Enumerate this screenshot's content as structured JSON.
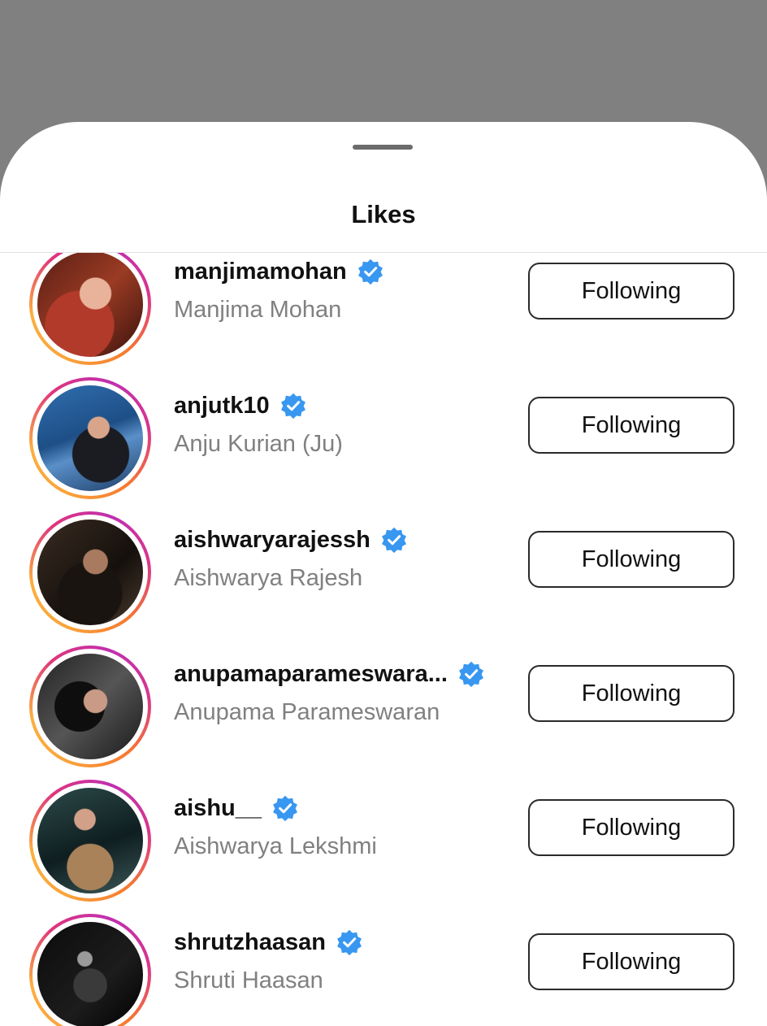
{
  "sheet": {
    "title": "Likes"
  },
  "accent": {
    "verified": "#3897f0",
    "ring_start": "#f9a23a",
    "ring_end": "#c02fb0"
  },
  "likes": [
    {
      "username": "manjimamohan",
      "full_name": "Manjima Mohan",
      "button": "Following",
      "verified": true
    },
    {
      "username": "anjutk10",
      "full_name": "Anju Kurian (Ju)",
      "button": "Following",
      "verified": true
    },
    {
      "username": "aishwaryarajessh",
      "full_name": "Aishwarya Rajesh",
      "button": "Following",
      "verified": true
    },
    {
      "username": "anupamaparameswara...",
      "full_name": "Anupama Parameswaran",
      "button": "Following",
      "verified": true
    },
    {
      "username": "aishu__",
      "full_name": "Aishwarya Lekshmi",
      "button": "Following",
      "verified": true
    },
    {
      "username": "shrutzhaasan",
      "full_name": "Shruti Haasan",
      "button": "Following",
      "verified": true
    }
  ]
}
